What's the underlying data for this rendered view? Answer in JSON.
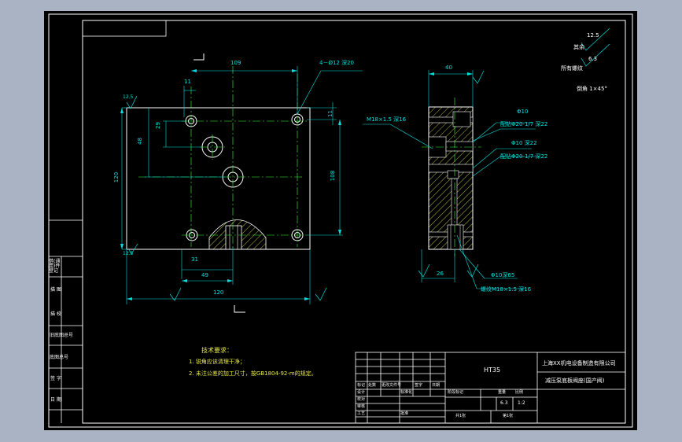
{
  "colors": {
    "viewport_bg": "#a9b3c3",
    "paper": "#000000",
    "frame": "#ffffff",
    "part": "#ffffff",
    "dimension": "#00e0e0",
    "centerline": "#3aff3a",
    "hatch": "#e8e84a",
    "notes": "#e8e84a"
  },
  "front_view_dims": {
    "top_width": "109",
    "hole_callout": "4－Ø12 深20",
    "left_offset": "11",
    "top_offset": "11",
    "dim_29": "29",
    "dim_48": "48",
    "height_120": "120",
    "height_108": "108",
    "dim_31": "31",
    "dim_49": "49",
    "bottom_width": "120",
    "roughness_top": "12.5",
    "roughness_bottom": "12.5"
  },
  "side_view_dims": {
    "width_40": "40",
    "thread_top": "M18×1.5 深16",
    "hole_phi10": "Φ10",
    "pin_hole_1": "配钻Φ20-1/7 深22",
    "hole_phi10_depth": "Φ10 深22",
    "pin_hole_2": "配钻Φ20-1/7 深22",
    "dim_26": "26",
    "hole_bottom": "Φ10深65",
    "thread_bottom": "螺纹M18×1.5 深16"
  },
  "surface_finish": {
    "value_1": "12.5",
    "label_1": "其余",
    "value_2": "6.3",
    "label_2": "所有螺纹",
    "chamfer": "倒角 1×45°"
  },
  "tech_requirements": {
    "title": "技术要求：",
    "items": [
      "1. 锐角应该清理干净；",
      "2. 未注公差的加工尺寸，按GB1804-92-m的规定。"
    ]
  },
  "left_strip": [
    "借(通用)件登记",
    "描 图",
    "描 校",
    "旧底图总号",
    "底图总号",
    "签 字",
    "日 期"
  ],
  "title_block": {
    "material": "HT35",
    "company": "上海XX机电设备制造有限公司",
    "part_name": "减压泵底板阀座(国产阀)",
    "header_cols": [
      "标记",
      "处数",
      "更改文件号",
      "签字",
      "日期"
    ],
    "row_labels": [
      "设计",
      "校对",
      "审核",
      "工艺"
    ],
    "row_values": [
      "",
      "",
      "",
      "标准化",
      "批准"
    ],
    "stage_labels": [
      "阶段标记",
      "重量",
      "比例"
    ],
    "scale": "1:2",
    "weight": "6.3",
    "sheet_total": "共1张",
    "sheet_no": "第1张"
  }
}
